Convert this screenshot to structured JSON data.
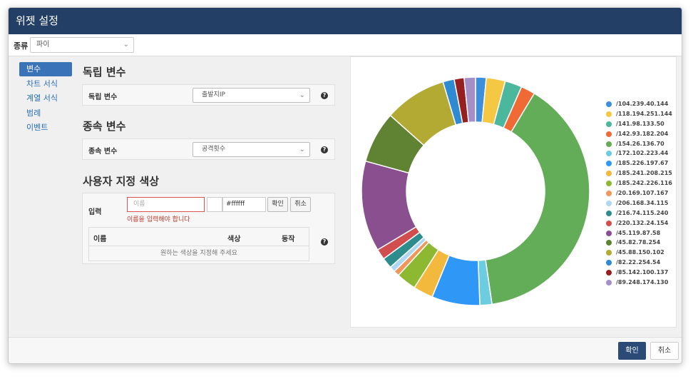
{
  "title": "위젯 설정",
  "type": {
    "label": "종류",
    "value": "파이"
  },
  "sidebar": [
    {
      "label": "변수",
      "active": true
    },
    {
      "label": "차트 서식",
      "active": false
    },
    {
      "label": "계열 서식",
      "active": false
    },
    {
      "label": "범례",
      "active": false
    },
    {
      "label": "이벤트",
      "active": false
    }
  ],
  "independent": {
    "section_title": "독립 변수",
    "label": "독립 변수",
    "value": "출발지IP"
  },
  "dependent": {
    "section_title": "종속 변수",
    "label": "종속 변수",
    "value": "공격횟수"
  },
  "custom_color": {
    "section_title": "사용자 지정 색상",
    "input_label": "입력",
    "name_placeholder": "이름",
    "error_text": "이름을 입력해야 합니다",
    "hex_value": "#ffffff",
    "confirm_label": "확인",
    "cancel_label": "취소",
    "columns": [
      "이름",
      "색상",
      "동작"
    ],
    "empty_text": "원하는 색상을 지정해 주세요"
  },
  "footer": {
    "ok_label": "확인",
    "cancel_label": "취소"
  },
  "chart_data": {
    "type": "pie",
    "donut": true,
    "labels": [
      "/104.239.40.144",
      "/118.194.251.144",
      "/141.98.133.50",
      "/142.93.182.204",
      "/154.26.136.70",
      "/172.102.223.44",
      "/185.226.197.67",
      "/185.241.208.215",
      "/185.242.226.116",
      "/20.169.107.167",
      "/206.168.34.115",
      "/216.74.115.240",
      "/220.132.24.154",
      "/45.119.87.58",
      "/45.82.78.254",
      "/45.88.150.102",
      "/82.22.254.54",
      "/85.142.100.137",
      "/89.248.174.130"
    ],
    "values": [
      1.5,
      2.7,
      2.4,
      2.0,
      39.0,
      1.7,
      6.8,
      2.8,
      2.8,
      0.8,
      0.8,
      1.5,
      1.5,
      12.8,
      7.3,
      8.8,
      1.6,
      1.4,
      1.6
    ],
    "colors": [
      "#3d8fdb",
      "#f4c842",
      "#4bb89e",
      "#f06a36",
      "#64ad58",
      "#6dcde0",
      "#2f97f5",
      "#f3b93c",
      "#8db832",
      "#f0985b",
      "#aed7f3",
      "#2d8c8c",
      "#d24e4e",
      "#894f8e",
      "#5f8233",
      "#b3aa34",
      "#2e8bd1",
      "#961f1f",
      "#a58fc7"
    ],
    "legend": "right"
  }
}
